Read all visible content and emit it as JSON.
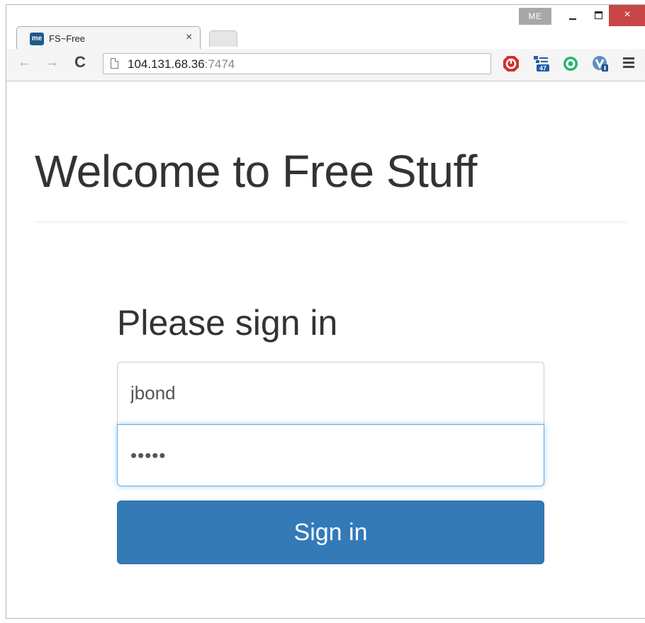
{
  "window": {
    "user_badge": "ME",
    "close_glyph": "×",
    "colors": {
      "close": "#c84646",
      "badge": "#a8a8a8"
    }
  },
  "tab": {
    "favicon_text": "me",
    "title": "FS~Free",
    "close_glyph": "×"
  },
  "toolbar": {
    "back_icon": "←",
    "forward_icon": "→",
    "reload_icon": "C",
    "url_host": "104.131.68.36",
    "url_port": ":7474",
    "extensions": [
      "stop-extension-icon",
      "tree-extension-icon",
      "ring-extension-icon",
      "v-extension-icon"
    ],
    "ext_badge": "47"
  },
  "page": {
    "title": "Welcome to Free Stuff",
    "signin_heading": "Please sign in",
    "username_value": "jbond",
    "password_value": "•••••",
    "signin_label": "Sign in",
    "colors": {
      "primary": "#337ab7",
      "focus": "#66afe9",
      "text": "#333333"
    }
  }
}
